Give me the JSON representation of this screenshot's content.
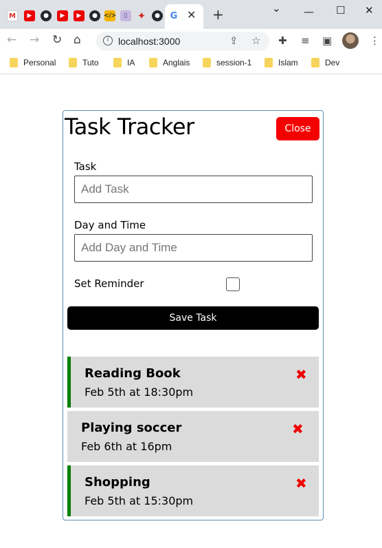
{
  "browser": {
    "favicons": [
      "gmail-icon",
      "youtube-icon",
      "github-icon",
      "youtube-icon",
      "youtube-icon",
      "github-icon",
      "code-icon",
      "library-icon",
      "canada-icon",
      "github-icon",
      "google-icon"
    ],
    "url": "localhost:3000",
    "bookmarks": [
      "Personal",
      "Tuto",
      "IA",
      "Anglais",
      "session-1",
      "Islam",
      "Dev"
    ]
  },
  "app": {
    "title": "Task Tracker",
    "close_label": "Close",
    "form": {
      "task_label": "Task",
      "task_placeholder": "Add Task",
      "day_label": "Day and Time",
      "day_placeholder": "Add Day and Time",
      "reminder_label": "Set Reminder",
      "save_label": "Save Task"
    },
    "tasks": [
      {
        "text": "Reading Book",
        "day": "Feb 5th at 18:30pm",
        "reminder": true
      },
      {
        "text": "Playing soccer",
        "day": "Feb 6th at 16pm",
        "reminder": false
      },
      {
        "text": "Shopping",
        "day": "Feb 5th at 15:30pm",
        "reminder": true
      }
    ],
    "colors": {
      "accent_red": "#f50000",
      "reminder_green": "#008000",
      "task_bg": "#dcdbdb"
    }
  }
}
